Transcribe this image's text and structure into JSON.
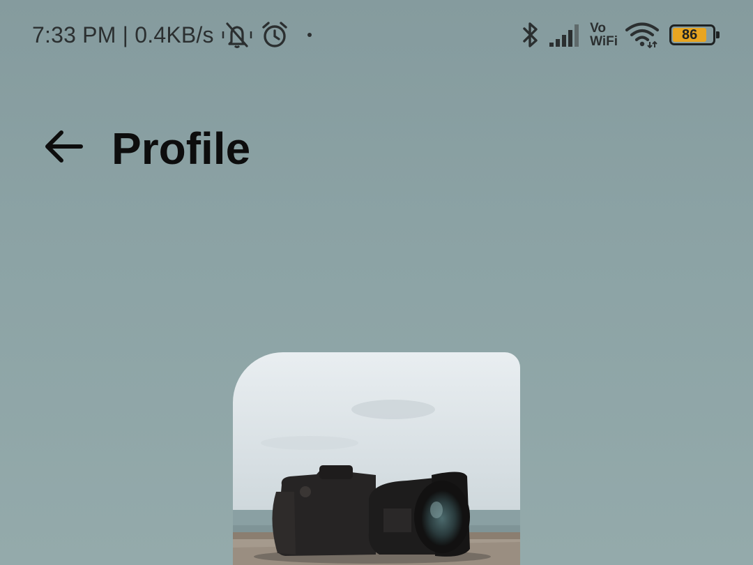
{
  "status_bar": {
    "time_speed": "7:33 PM | 0.4KB/s",
    "network_label_top": "Vo",
    "network_label_bottom": "WiFi",
    "battery_level": "86",
    "battery_fraction": 0.86,
    "icons": [
      "bell-off-icon",
      "alarm-icon",
      "notification-dot",
      "bluetooth-icon",
      "signal-icon",
      "wifi-icon",
      "battery-icon"
    ]
  },
  "header": {
    "title": "Profile",
    "back_icon": "arrow-left-icon"
  },
  "profile": {
    "photo_subject": "camera-photo"
  },
  "colors": {
    "background": "#8ca3a5",
    "battery_fill": "#e8a521",
    "title_text": "#0d0d0d"
  }
}
